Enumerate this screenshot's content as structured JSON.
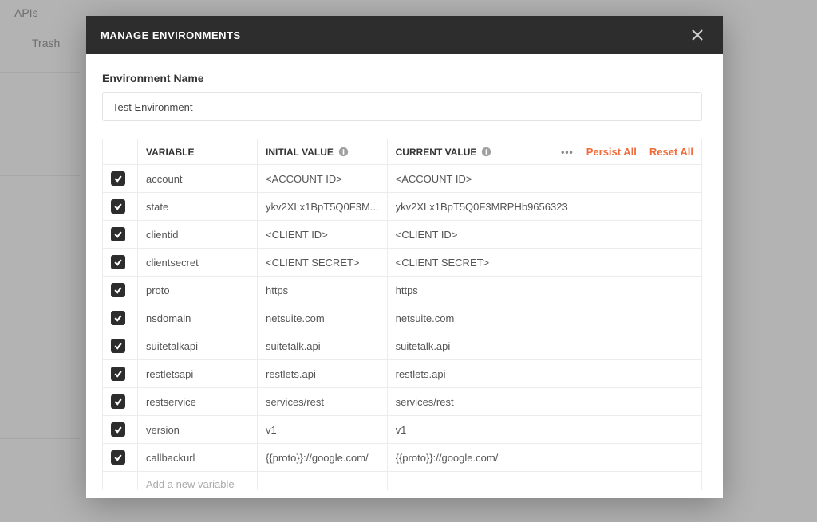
{
  "background": {
    "apis_label": "APIs",
    "trash_label": "Trash"
  },
  "modal": {
    "title": "MANAGE ENVIRONMENTS",
    "env_name_label": "Environment Name",
    "env_name_value": "Test Environment",
    "headers": {
      "variable": "VARIABLE",
      "initial": "INITIAL VALUE",
      "current": "CURRENT VALUE"
    },
    "actions": {
      "persist": "Persist All",
      "reset": "Reset All"
    },
    "add_placeholder": "Add a new variable",
    "rows": [
      {
        "checked": true,
        "variable": "account",
        "initial": "<ACCOUNT ID>",
        "current": "<ACCOUNT ID>"
      },
      {
        "checked": true,
        "variable": "state",
        "initial": "ykv2XLx1BpT5Q0F3M...",
        "current": "ykv2XLx1BpT5Q0F3MRPHb9656323"
      },
      {
        "checked": true,
        "variable": "clientid",
        "initial": "<CLIENT ID>",
        "current": "<CLIENT ID>"
      },
      {
        "checked": true,
        "variable": "clientsecret",
        "initial": "<CLIENT SECRET>",
        "current": "<CLIENT SECRET>"
      },
      {
        "checked": true,
        "variable": "proto",
        "initial": "https",
        "current": "https"
      },
      {
        "checked": true,
        "variable": "nsdomain",
        "initial": "netsuite.com",
        "current": "netsuite.com"
      },
      {
        "checked": true,
        "variable": "suitetalkapi",
        "initial": "suitetalk.api",
        "current": "suitetalk.api"
      },
      {
        "checked": true,
        "variable": "restletsapi",
        "initial": "restlets.api",
        "current": "restlets.api"
      },
      {
        "checked": true,
        "variable": "restservice",
        "initial": "services/rest",
        "current": "services/rest"
      },
      {
        "checked": true,
        "variable": "version",
        "initial": "v1",
        "current": "v1"
      },
      {
        "checked": true,
        "variable": "callbackurl",
        "initial": "{{proto}}://google.com/",
        "current": "{{proto}}://google.com/"
      }
    ]
  }
}
